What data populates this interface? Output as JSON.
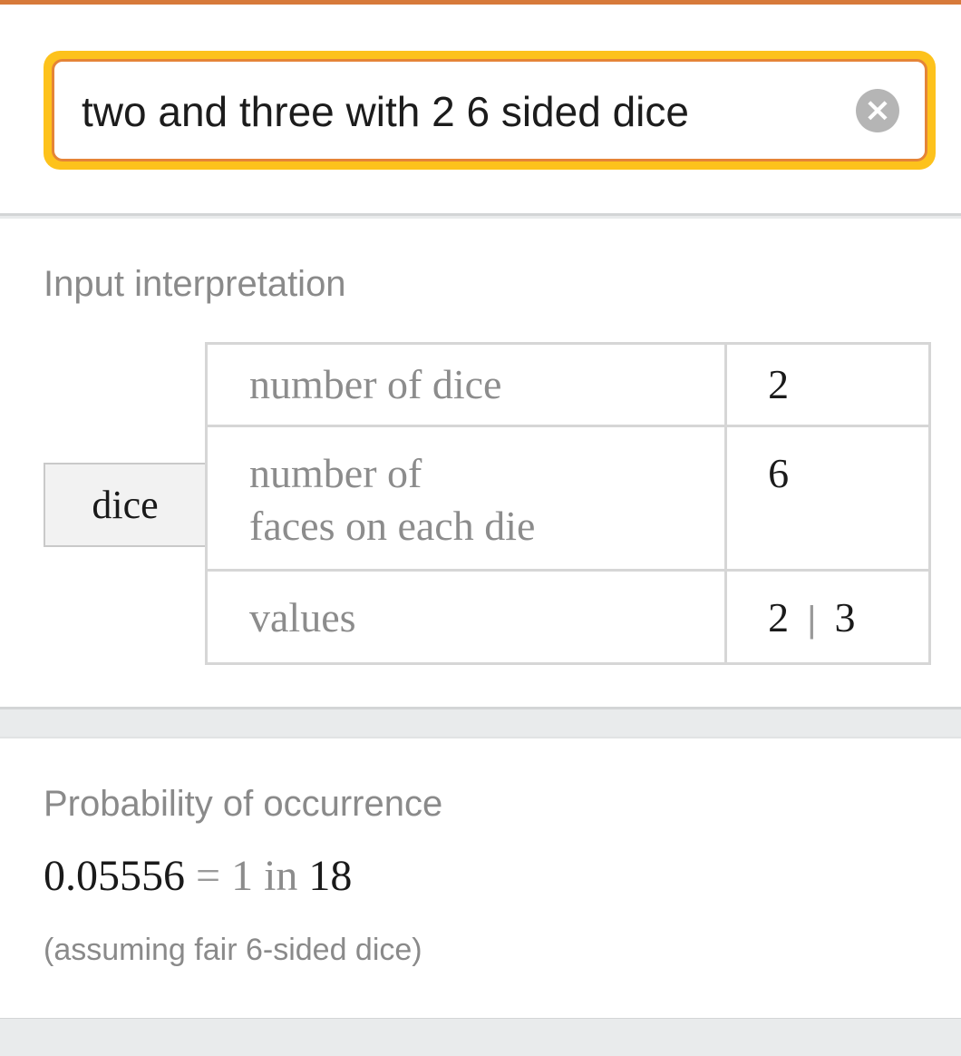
{
  "search": {
    "query": "two and three with 2 6 sided dice",
    "clear_icon": "close-circle-icon"
  },
  "input_interpretation": {
    "title": "Input interpretation",
    "entity": "dice",
    "rows": [
      {
        "label": "number of dice",
        "value": "2"
      },
      {
        "label_line1": "number of",
        "label_line2": "faces on each die",
        "value": "6"
      },
      {
        "label": "values",
        "value_a": "2",
        "separator": "|",
        "value_b": "3"
      }
    ]
  },
  "probability": {
    "title": "Probability of occurrence",
    "decimal": "0.05556",
    "equals": "=",
    "numerator": "1",
    "in_word": "in",
    "denominator": "18",
    "note": "(assuming fair 6-sided dice)"
  },
  "colors": {
    "accent_orange": "#e58437",
    "highlight_yellow": "#fdc21c"
  }
}
